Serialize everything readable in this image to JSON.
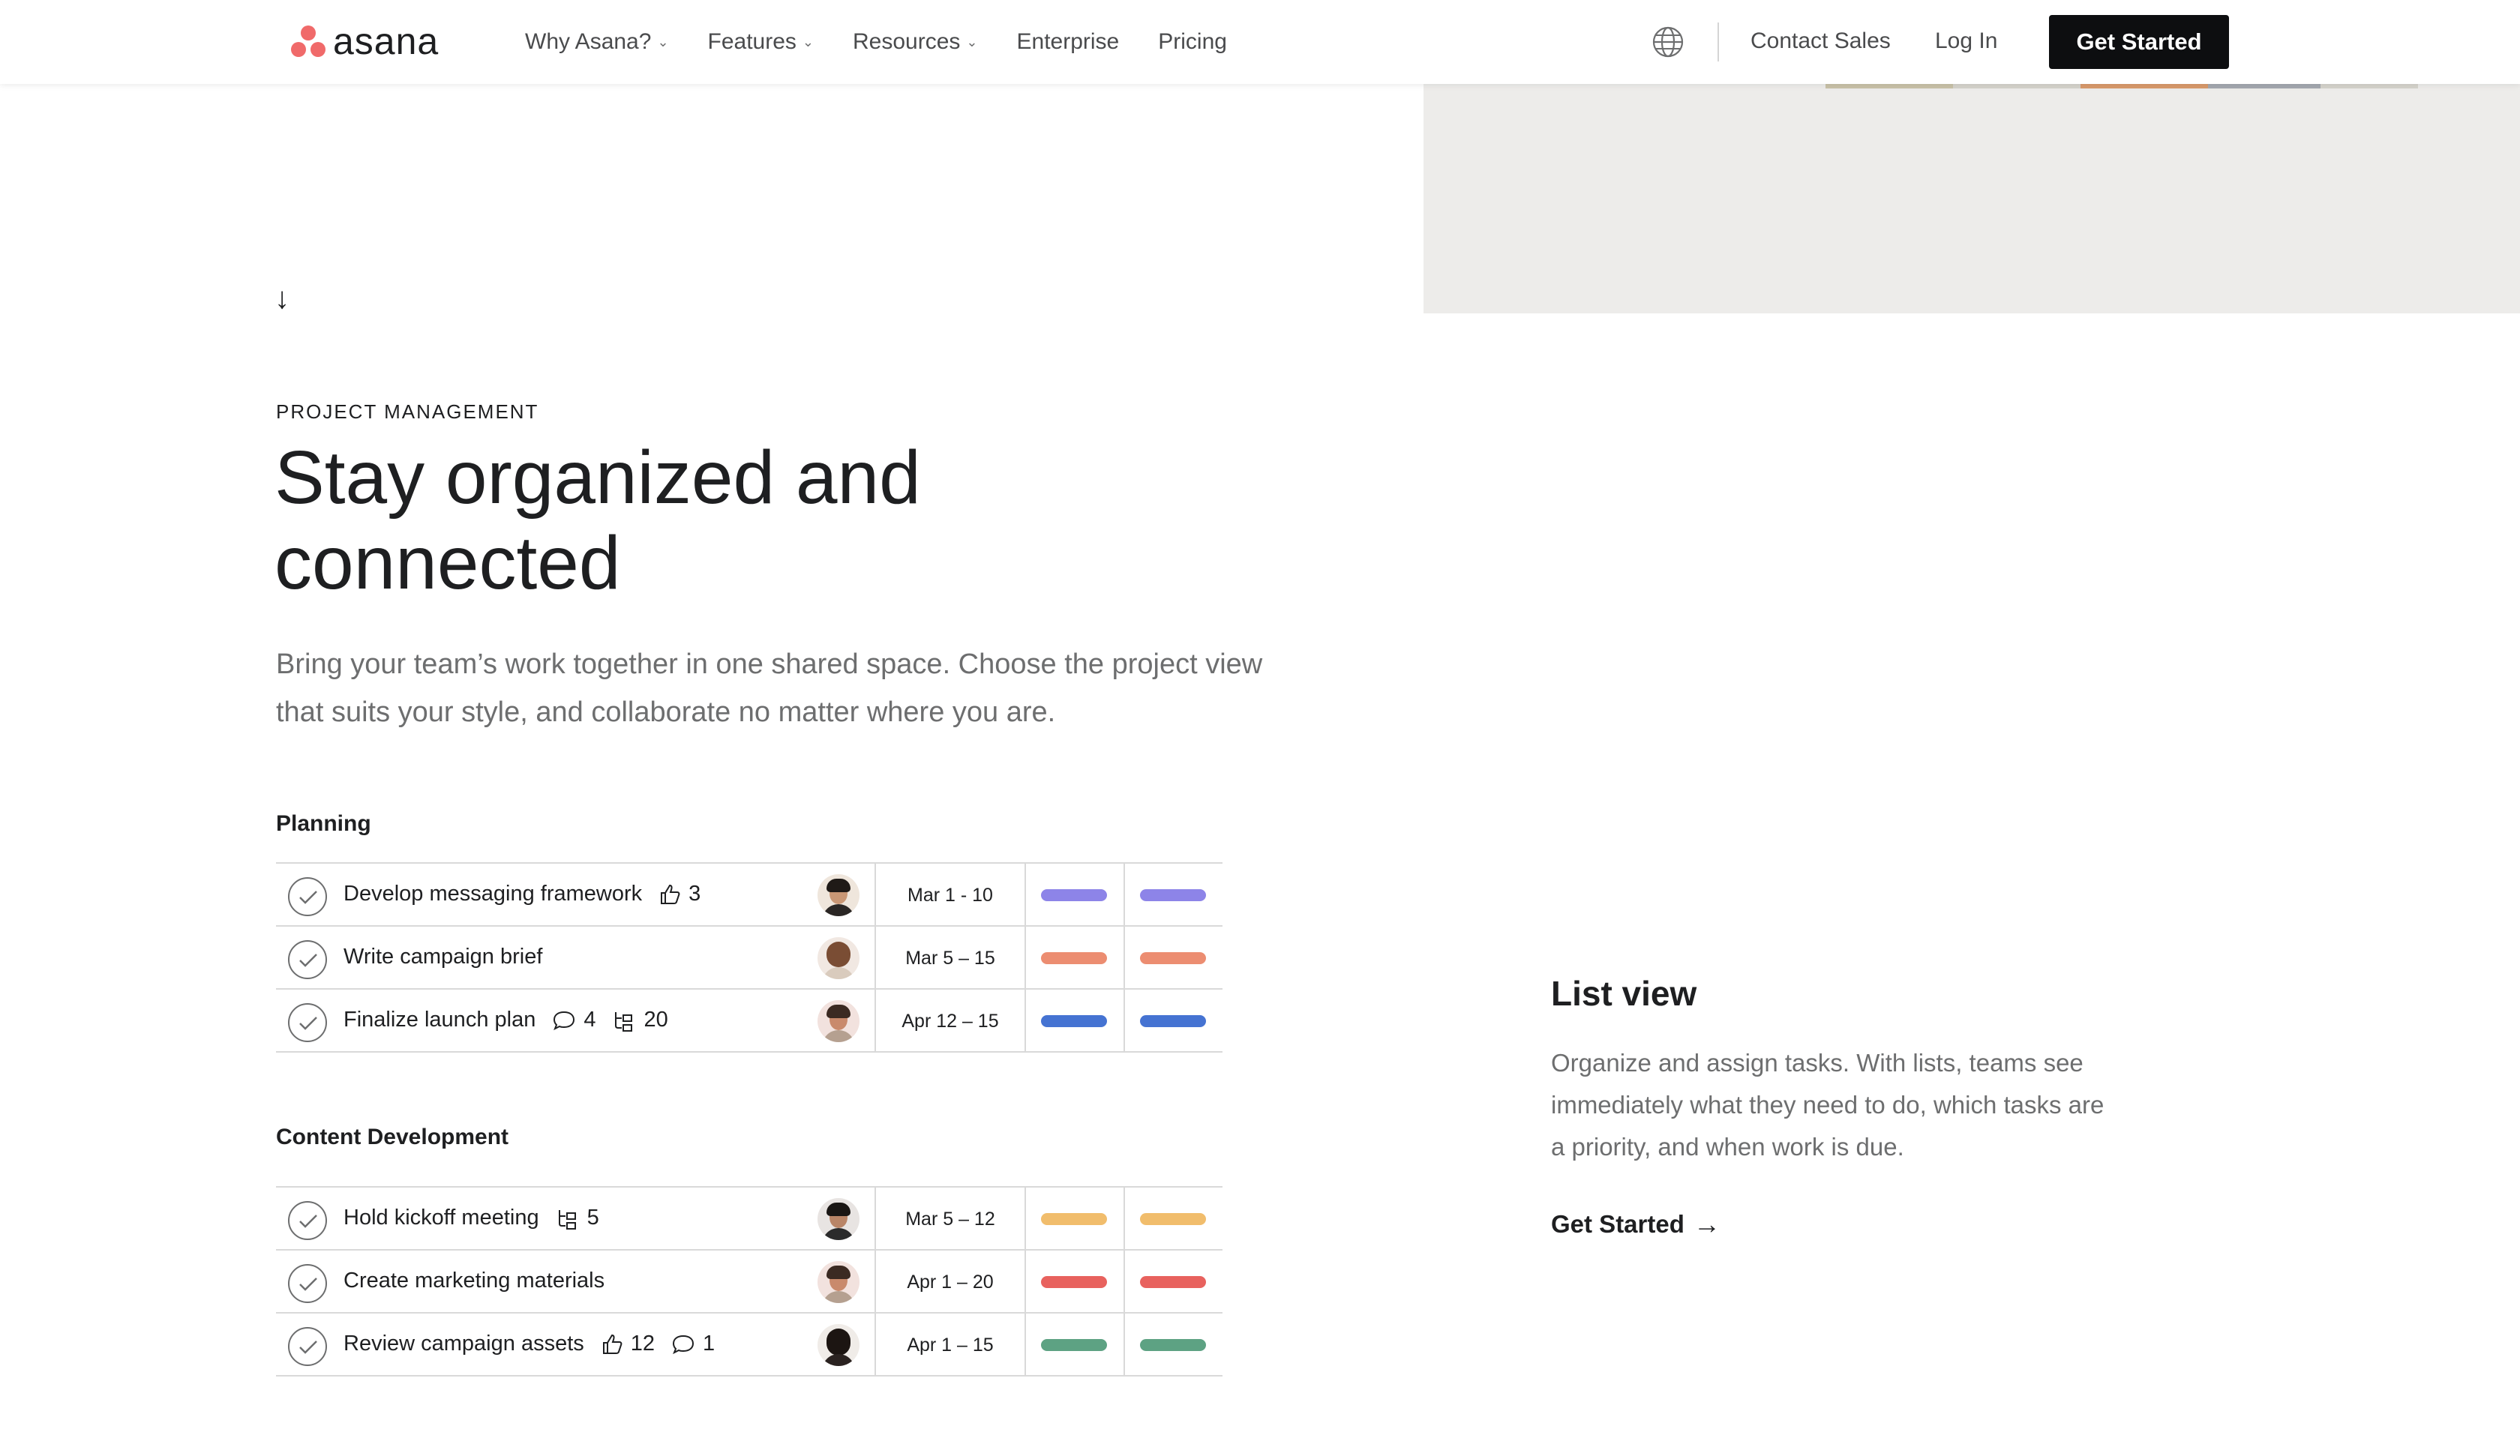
{
  "header": {
    "logo_text": "asana",
    "nav": [
      {
        "label": "Why Asana?",
        "has_dropdown": true
      },
      {
        "label": "Features",
        "has_dropdown": true
      },
      {
        "label": "Resources",
        "has_dropdown": true
      },
      {
        "label": "Enterprise",
        "has_dropdown": false
      },
      {
        "label": "Pricing",
        "has_dropdown": false
      }
    ],
    "contact_sales": "Contact Sales",
    "login": "Log In",
    "get_started": "Get Started",
    "icons": {
      "language": "globe-icon",
      "dropdown": "chevron-down-icon"
    }
  },
  "hero": {
    "eyebrow": "PROJECT MANAGEMENT",
    "headline": "Stay organized and connected",
    "subtext": "Bring your team’s work together in one shared space. Choose the project view that suits your style, and collaborate no matter where you are."
  },
  "sections": [
    {
      "label": "Planning",
      "tasks": [
        {
          "name": "Develop messaging framework",
          "likes": "3",
          "date": "Mar 1 - 10",
          "color": "#8d84e8"
        },
        {
          "name": "Write campaign brief",
          "date": "Mar 5 – 15",
          "color": "#ec8d71"
        },
        {
          "name": "Finalize launch plan",
          "comments": "4",
          "subtasks": "20",
          "date": "Apr 12 – 15",
          "color": "#4573d2"
        }
      ]
    },
    {
      "label": "Content Development",
      "tasks": [
        {
          "name": "Hold kickoff meeting",
          "subtasks": "5",
          "date": "Mar 5 – 12",
          "color": "#f1bd6c"
        },
        {
          "name": "Create marketing materials",
          "date": "Apr 1 – 20",
          "color": "#e8625e"
        },
        {
          "name": "Review campaign assets",
          "likes": "12",
          "comments": "1",
          "date": "Apr 1 – 15",
          "color": "#5da283"
        }
      ]
    }
  ],
  "feature": {
    "title": "List view",
    "description": "Organize and assign tasks. With lists, teams see immediately what they need to do, which tasks are a priority, and when work is due.",
    "link": "Get Started",
    "link_icon": "arrow-right-icon"
  },
  "colors": {
    "accent": "#f06a6a",
    "cta_bg": "#0d0e10",
    "text_muted": "#6d6e6f"
  }
}
